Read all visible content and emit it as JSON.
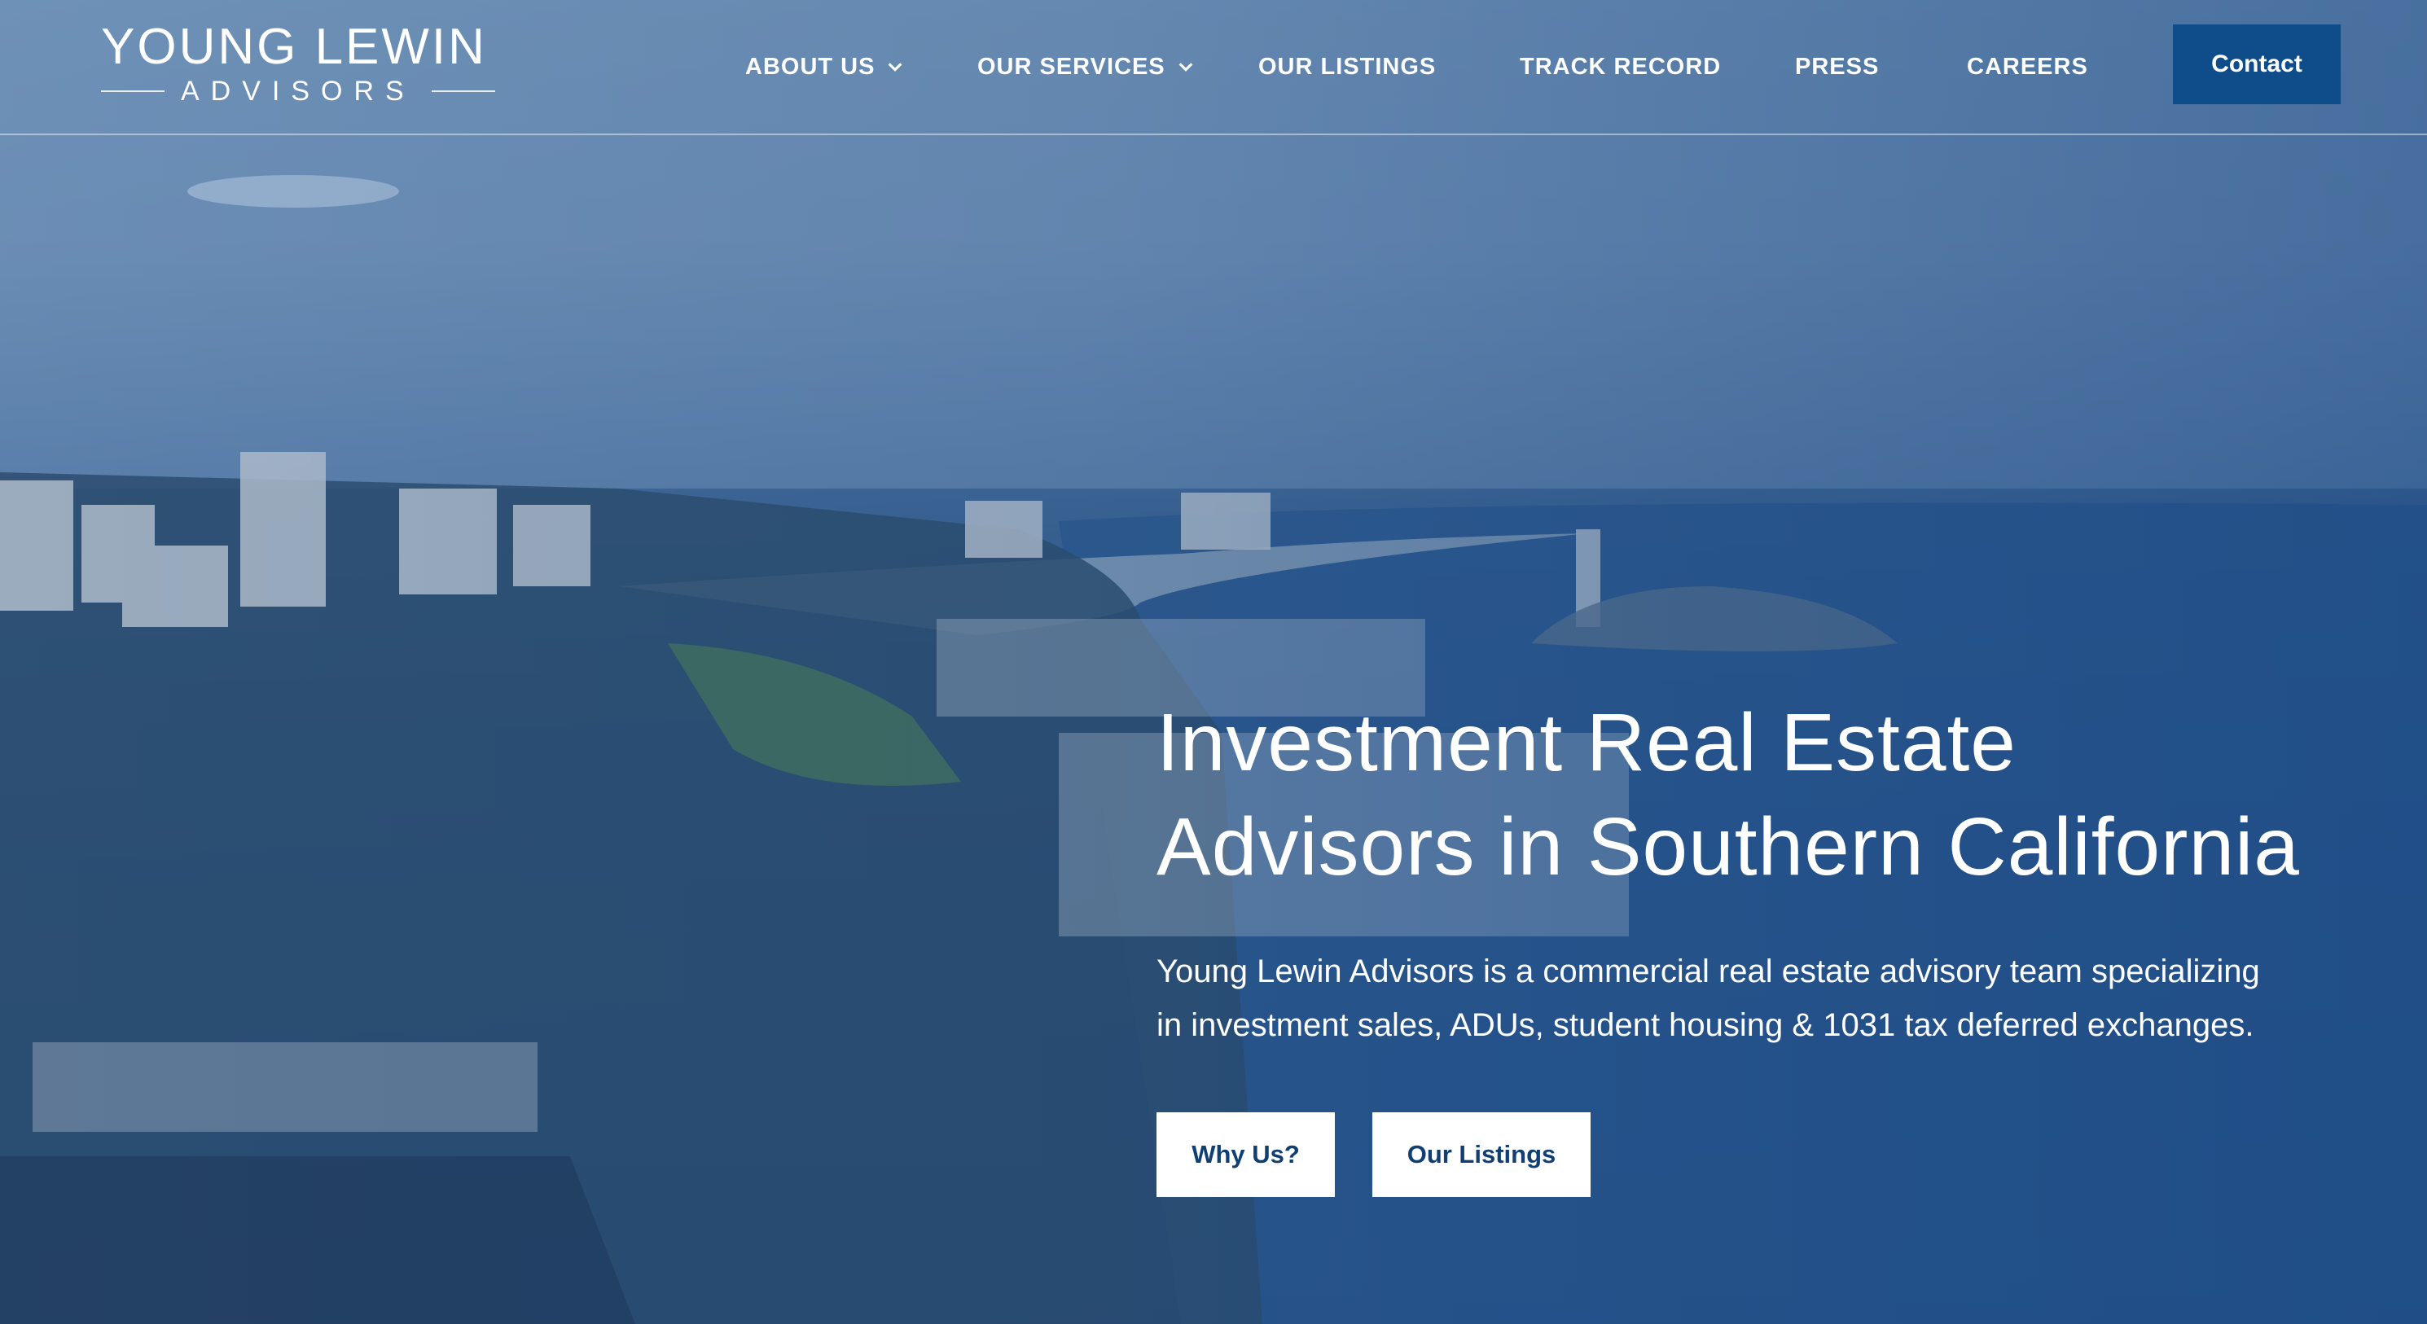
{
  "brand": {
    "logo_top": "YOUNG LEWIN",
    "logo_bottom": "ADVISORS"
  },
  "nav": {
    "items": [
      {
        "label": "ABOUT US",
        "dropdown": true
      },
      {
        "label": "OUR SERVICES",
        "dropdown": true
      },
      {
        "label": "OUR LISTINGS",
        "dropdown": false
      },
      {
        "label": "TRACK RECORD",
        "dropdown": false
      },
      {
        "label": "PRESS",
        "dropdown": false
      },
      {
        "label": "CAREERS",
        "dropdown": false
      }
    ],
    "contact_label": "Contact"
  },
  "hero": {
    "title_line1": "Investment Real Estate",
    "title_line2": "Advisors in Southern California",
    "desc_line1": "Young Lewin Advisors is a commercial real estate advisory team specializing",
    "desc_line2": "in investment sales, ADUs, student housing & 1031 tax deferred exchanges.",
    "buttons": {
      "why_us": "Why Us?",
      "listings": "Our Listings"
    }
  },
  "colors": {
    "accent": "#0f4c8a",
    "button_text": "#0f3f73",
    "background": "#2d588d"
  },
  "icons": {
    "dropdown": "chevron-down-icon"
  }
}
